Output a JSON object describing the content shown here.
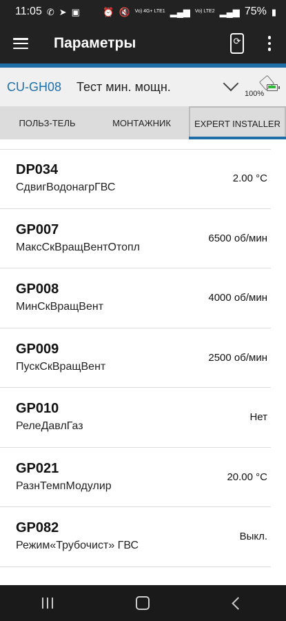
{
  "status": {
    "time": "11:05",
    "battery": "75%",
    "lte1": "Vo) 4G+ LTE1",
    "lte2": "Vo) LTE2"
  },
  "header": {
    "title": "Параметры"
  },
  "device": {
    "code": "CU-GH08",
    "name": "Тест мин. мощн.",
    "battery_percent": "100%",
    "battery_level": 1.0
  },
  "tabs": [
    {
      "label": "ПОЛЬЗ-ТЕЛЬ"
    },
    {
      "label": "МОНТАЖНИК"
    },
    {
      "label": "EXPERT INSTALLER",
      "active": true
    }
  ],
  "params": [
    {
      "code": "DP034",
      "name": "СдвигВодонагрГВС",
      "value": "2.00 °C"
    },
    {
      "code": "GP007",
      "name": "МаксСкВращВентОтопл",
      "value": "6500 об/мин"
    },
    {
      "code": "GP008",
      "name": "МинСкВращВент",
      "value": "4000 об/мин"
    },
    {
      "code": "GP009",
      "name": "ПускСкВращВент",
      "value": "2500 об/мин"
    },
    {
      "code": "GP010",
      "name": "РелеДавлГаз",
      "value": "Нет"
    },
    {
      "code": "GP021",
      "name": "РазнТемпМодулир",
      "value": "20.00 °C"
    },
    {
      "code": "GP082",
      "name": "Режим«Трубочист» ГВС",
      "value": "Выкл."
    }
  ],
  "colors": {
    "accent": "#1e6fa8",
    "appbar": "#222222",
    "battery_green": "#2dbb3a"
  }
}
